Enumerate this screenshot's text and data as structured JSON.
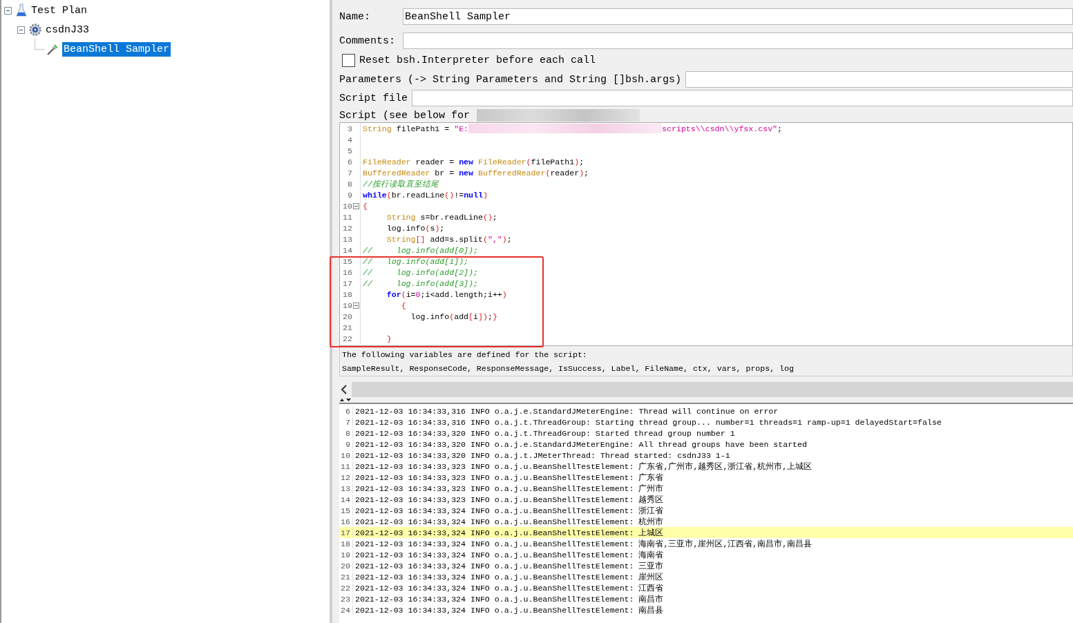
{
  "tree": {
    "items": [
      {
        "label": "Test Plan",
        "kind": "plan",
        "expanded": true,
        "selected": false,
        "children": [
          {
            "label": "csdnJ33",
            "kind": "thread_group",
            "expanded": true,
            "selected": false,
            "children": [
              {
                "label": "BeanShell Sampler",
                "kind": "sampler",
                "selected": true
              }
            ]
          }
        ]
      }
    ]
  },
  "form": {
    "name_label": "Name:",
    "name_value": "BeanShell Sampler",
    "comments_label": "Comments:",
    "reset_label": "Reset bsh.Interpreter before each call",
    "reset_checked": false,
    "parameters_label": "Parameters (-> String Parameters and String []bsh.args)",
    "script_file_label": "Script file",
    "script_label": "Script (see below for"
  },
  "code_lines": [
    {
      "number": "3",
      "foldable": false,
      "tokens": [
        {
          "kind": "type",
          "text": "String"
        },
        {
          "kind": "plain",
          "text": " filePath1 = "
        },
        {
          "kind": "string",
          "text": "\"E:"
        },
        {
          "kind": "redacted"
        },
        {
          "kind": "string",
          "text": "scripts\\\\csdn\\\\yfsx.csv\""
        },
        {
          "kind": "plain",
          "text": ";"
        }
      ]
    },
    {
      "number": "4",
      "foldable": false
    },
    {
      "number": "5",
      "foldable": false
    },
    {
      "number": "6",
      "foldable": false,
      "tokens": [
        {
          "kind": "type",
          "text": "FileReader"
        },
        {
          "kind": "plain",
          "text": " reader = "
        },
        {
          "kind": "keyword",
          "text": "new"
        },
        {
          "kind": "type",
          "text": " FileReader"
        },
        {
          "kind": "punct",
          "text": "("
        },
        {
          "kind": "plain",
          "text": "filePath1"
        },
        {
          "kind": "punct",
          "text": ")"
        },
        {
          "kind": "plain",
          "text": ";"
        }
      ]
    },
    {
      "number": "7",
      "foldable": false,
      "tokens": [
        {
          "kind": "type",
          "text": "BufferedReader"
        },
        {
          "kind": "plain",
          "text": " br = "
        },
        {
          "kind": "keyword",
          "text": "new"
        },
        {
          "kind": "type",
          "text": " BufferedReader"
        },
        {
          "kind": "punct",
          "text": "("
        },
        {
          "kind": "plain",
          "text": "reader"
        },
        {
          "kind": "punct",
          "text": ")"
        },
        {
          "kind": "plain",
          "text": ";"
        }
      ]
    },
    {
      "number": "8",
      "foldable": false,
      "tokens": [
        {
          "kind": "comment",
          "text": "//按行读取直至结尾"
        }
      ]
    },
    {
      "number": "9",
      "foldable": false,
      "tokens": [
        {
          "kind": "keyword",
          "text": "while"
        },
        {
          "kind": "punct",
          "text": "("
        },
        {
          "kind": "plain",
          "text": "br.readLine"
        },
        {
          "kind": "punct",
          "text": "()"
        },
        {
          "kind": "plain",
          "text": "!="
        },
        {
          "kind": "keyword",
          "text": "null"
        },
        {
          "kind": "punct",
          "text": ")"
        }
      ]
    },
    {
      "number": "10",
      "foldable": true,
      "tokens": [
        {
          "kind": "punct",
          "text": "{"
        }
      ]
    },
    {
      "number": "11",
      "foldable": false,
      "tokens": [
        {
          "kind": "type",
          "text": "     String"
        },
        {
          "kind": "plain",
          "text": " s=br.readLine"
        },
        {
          "kind": "punct",
          "text": "()"
        },
        {
          "kind": "plain",
          "text": ";"
        }
      ]
    },
    {
      "number": "12",
      "foldable": false,
      "tokens": [
        {
          "kind": "plain",
          "text": "     log.info"
        },
        {
          "kind": "punct",
          "text": "("
        },
        {
          "kind": "plain",
          "text": "s"
        },
        {
          "kind": "punct",
          "text": ")"
        },
        {
          "kind": "plain",
          "text": ";"
        }
      ]
    },
    {
      "number": "13",
      "foldable": false,
      "tokens": [
        {
          "kind": "type",
          "text": "     String"
        },
        {
          "kind": "punct",
          "text": "[]"
        },
        {
          "kind": "plain",
          "text": " add=s.split"
        },
        {
          "kind": "punct",
          "text": "("
        },
        {
          "kind": "string",
          "text": "\",\""
        },
        {
          "kind": "punct",
          "text": ")"
        },
        {
          "kind": "plain",
          "text": ";"
        }
      ]
    },
    {
      "number": "14",
      "foldable": false,
      "tokens": [
        {
          "kind": "comment",
          "text": "//     log.info(add[0]);"
        }
      ]
    },
    {
      "number": "15",
      "foldable": false,
      "tokens": [
        {
          "kind": "comment",
          "text": "//   log.info(add[1]);"
        }
      ]
    },
    {
      "number": "16",
      "foldable": false,
      "tokens": [
        {
          "kind": "comment",
          "text": "//     log.info(add[2]);"
        }
      ]
    },
    {
      "number": "17",
      "foldable": false,
      "tokens": [
        {
          "kind": "comment",
          "text": "//     log.info(add[3]);"
        }
      ]
    },
    {
      "number": "18",
      "foldable": false,
      "tokens": [
        {
          "kind": "keyword",
          "text": "     for"
        },
        {
          "kind": "punct",
          "text": "("
        },
        {
          "kind": "plain",
          "text": "i="
        },
        {
          "kind": "number",
          "text": "0"
        },
        {
          "kind": "plain",
          "text": ";i<add.length;i++"
        },
        {
          "kind": "punct",
          "text": ")"
        }
      ]
    },
    {
      "number": "19",
      "foldable": true,
      "tokens": [
        {
          "kind": "punct",
          "text": "        {"
        }
      ]
    },
    {
      "number": "20",
      "foldable": false,
      "tokens": [
        {
          "kind": "plain",
          "text": "          log.info"
        },
        {
          "kind": "punct",
          "text": "("
        },
        {
          "kind": "plain",
          "text": "add"
        },
        {
          "kind": "punct",
          "text": "["
        },
        {
          "kind": "plain",
          "text": "i"
        },
        {
          "kind": "punct",
          "text": "])"
        },
        {
          "kind": "plain",
          "text": ";"
        },
        {
          "kind": "punct",
          "text": "}"
        }
      ]
    },
    {
      "number": "21",
      "foldable": false
    },
    {
      "number": "22",
      "foldable": false,
      "tokens": [
        {
          "kind": "punct",
          "text": "     }"
        }
      ]
    }
  ],
  "variables_note": [
    "The following variables are defined for the script:",
    "SampleResult, ResponseCode, ResponseMessage, IsSuccess, Label, FileName, ctx, vars, props, log"
  ],
  "log_lines": [
    {
      "number": "6",
      "text": "2021-12-03 16:34:33,316 INFO o.a.j.e.StandardJMeterEngine: Thread will continue on error",
      "selected": false
    },
    {
      "number": "7",
      "text": "2021-12-03 16:34:33,316 INFO o.a.j.t.ThreadGroup: Starting thread group... number=1 threads=1 ramp-up=1 delayedStart=false",
      "selected": false
    },
    {
      "number": "8",
      "text": "2021-12-03 16:34:33,320 INFO o.a.j.t.ThreadGroup: Started thread group number 1",
      "selected": false
    },
    {
      "number": "9",
      "text": "2021-12-03 16:34:33,320 INFO o.a.j.e.StandardJMeterEngine: All thread groups have been started",
      "selected": false
    },
    {
      "number": "10",
      "text": "2021-12-03 16:34:33,320 INFO o.a.j.t.JMeterThread: Thread started: csdnJ33 1-1",
      "selected": false
    },
    {
      "number": "11",
      "text": "2021-12-03 16:34:33,323 INFO o.a.j.u.BeanShellTestElement: 广东省,广州市,越秀区,浙江省,杭州市,上城区",
      "selected": false
    },
    {
      "number": "12",
      "text": "2021-12-03 16:34:33,323 INFO o.a.j.u.BeanShellTestElement: 广东省",
      "selected": false
    },
    {
      "number": "13",
      "text": "2021-12-03 16:34:33,323 INFO o.a.j.u.BeanShellTestElement: 广州市",
      "selected": false
    },
    {
      "number": "14",
      "text": "2021-12-03 16:34:33,323 INFO o.a.j.u.BeanShellTestElement: 越秀区",
      "selected": false
    },
    {
      "number": "15",
      "text": "2021-12-03 16:34:33,324 INFO o.a.j.u.BeanShellTestElement: 浙江省",
      "selected": false
    },
    {
      "number": "16",
      "text": "2021-12-03 16:34:33,324 INFO o.a.j.u.BeanShellTestElement: 杭州市",
      "selected": false
    },
    {
      "number": "17",
      "text": "2021-12-03 16:34:33,324 INFO o.a.j.u.BeanShellTestElement: 上城区",
      "selected": true
    },
    {
      "number": "18",
      "text": "2021-12-03 16:34:33,324 INFO o.a.j.u.BeanShellTestElement: 海南省,三亚市,崖州区,江西省,南昌市,南昌县",
      "selected": false
    },
    {
      "number": "19",
      "text": "2021-12-03 16:34:33,324 INFO o.a.j.u.BeanShellTestElement: 海南省",
      "selected": false
    },
    {
      "number": "20",
      "text": "2021-12-03 16:34:33,324 INFO o.a.j.u.BeanShellTestElement: 三亚市",
      "selected": false
    },
    {
      "number": "21",
      "text": "2021-12-03 16:34:33,324 INFO o.a.j.u.BeanShellTestElement: 崖州区",
      "selected": false
    },
    {
      "number": "22",
      "text": "2021-12-03 16:34:33,324 INFO o.a.j.u.BeanShellTestElement: 江西省",
      "selected": false
    },
    {
      "number": "23",
      "text": "2021-12-03 16:34:33,324 INFO o.a.j.u.BeanShellTestElement: 南昌市",
      "selected": false
    },
    {
      "number": "24",
      "text": "2021-12-03 16:34:33,324 INFO o.a.j.u.BeanShellTestElement: 南昌县",
      "selected": false
    }
  ]
}
